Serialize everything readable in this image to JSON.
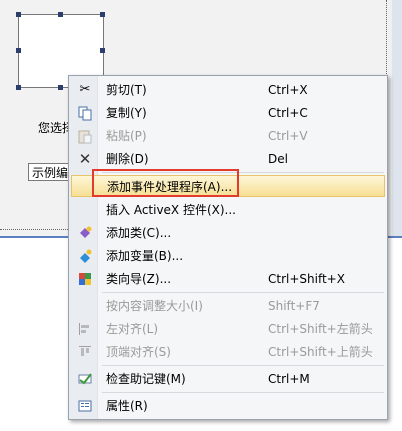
{
  "dialog": {
    "static_text": "您选择",
    "edit_value": "示例编"
  },
  "context_menu": {
    "items": [
      {
        "label": "剪切(T)",
        "shortcut": "Ctrl+X",
        "icon": "cut-icon",
        "enabled": true
      },
      {
        "label": "复制(Y)",
        "shortcut": "Ctrl+C",
        "icon": "copy-icon",
        "enabled": true
      },
      {
        "label": "粘贴(P)",
        "shortcut": "Ctrl+V",
        "icon": "paste-icon",
        "enabled": false
      },
      {
        "label": "删除(D)",
        "shortcut": "Del",
        "icon": "delete-icon",
        "enabled": true
      },
      {
        "label": "添加事件处理程序(A)...",
        "shortcut": "",
        "icon": "",
        "enabled": true,
        "highlighted": true
      },
      {
        "label": "插入 ActiveX 控件(X)...",
        "shortcut": "",
        "icon": "",
        "enabled": true
      },
      {
        "label": "添加类(C)...",
        "shortcut": "",
        "icon": "add-class-icon",
        "enabled": true
      },
      {
        "label": "添加变量(B)...",
        "shortcut": "",
        "icon": "add-variable-icon",
        "enabled": true
      },
      {
        "label": "类向导(Z)...",
        "shortcut": "Ctrl+Shift+X",
        "icon": "class-wizard-icon",
        "enabled": true
      },
      {
        "label": "按内容调整大小(I)",
        "shortcut": "Shift+F7",
        "icon": "",
        "enabled": false
      },
      {
        "label": "左对齐(L)",
        "shortcut": "Ctrl+Shift+左箭头",
        "icon": "align-left-icon",
        "enabled": false
      },
      {
        "label": "顶端对齐(S)",
        "shortcut": "Ctrl+Shift+上箭头",
        "icon": "align-top-icon",
        "enabled": false
      },
      {
        "label": "检查助记键(M)",
        "shortcut": "Ctrl+M",
        "icon": "check-mnemonics-icon",
        "enabled": true
      },
      {
        "label": "属性(R)",
        "shortcut": "",
        "icon": "properties-icon",
        "enabled": true
      }
    ]
  },
  "colors": {
    "highlight_border": "#e23b2e",
    "menu_hover": "#f6df94"
  }
}
